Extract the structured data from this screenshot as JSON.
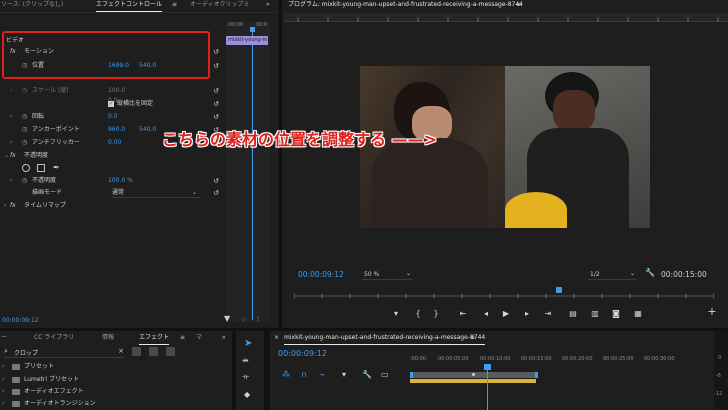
{
  "effect_controls": {
    "tabs": {
      "source": "ソース: (クリップなし)",
      "effect_controls": "エフェクトコントロール",
      "audio_mixer": "オーディオクリップミ"
    },
    "menu_glyph": "≡",
    "more_glyph": "»",
    "section_video": "ビデオ",
    "clip_name": "mixkit-young-m",
    "mini_ruler_start": ":00:00",
    "mini_ruler_end": "00:0",
    "motion": {
      "label": "モーション",
      "position_label": "位置",
      "position_x": "1699.0",
      "position_y": "540.0"
    },
    "scale": {
      "label": "スケール (縦)",
      "value": "100.0"
    },
    "uniform_scale": "縦横比を固定",
    "scale_width": "0.0",
    "rotation": {
      "label": "回転",
      "value": "0.0"
    },
    "anchor": {
      "label": "アンカーポイント",
      "x": "960.0",
      "y": "540.0"
    },
    "flicker": {
      "label": "アンチフリッカー",
      "value": "0.00"
    },
    "opacity": {
      "label": "不透明度",
      "sub_label": "不透明度",
      "value": "100.0 %",
      "blend_label": "描画モード",
      "blend_value": "通常"
    },
    "time_remap": "タイムリマップ",
    "timecode": "00:00:09:12"
  },
  "program": {
    "title": "プログラム: mixkit-young-man-upset-and-frustrated-receiving-a-message-8744",
    "menu_glyph": "≡",
    "annotation": "こちらの素材の位置を調整する ——>",
    "timecode": "00:00:09:12",
    "zoom": "50 %",
    "resolution": "1/2",
    "duration": "00:00:15:00",
    "wrench_icon": "wrench-icon"
  },
  "effects_panel": {
    "tabs": {
      "short": "ー",
      "cc": "CC ライブラリ",
      "info": "情報",
      "effects": "エフェクト",
      "more": "マ"
    },
    "search_value": "クロップ",
    "menu_glyph": "≡",
    "more_glyph": "»",
    "items": [
      "プリセット",
      "Lumetri プリセット",
      "オーディオエフェクト",
      "オーディオトランジション"
    ]
  },
  "timeline": {
    "close_glyph": "×",
    "title": "mixkit-young-man-upset-and-frustrated-receiving-a-message-8744",
    "menu_glyph": "≡",
    "timecode": "00:00:09:12",
    "ruler": [
      ":00:00",
      "00:00:05:00",
      "00:00:10:00",
      "00:00:15:00",
      "00:00:20:00",
      "00:00:25:00",
      "00:00:30:00"
    ],
    "right_scale": [
      "0",
      "-6",
      "-12"
    ]
  },
  "colors": {
    "accent": "#3d9cf0",
    "highlight_box": "#e0201b",
    "annotation_text": "#e0201b",
    "clip": "#9b8de0"
  }
}
